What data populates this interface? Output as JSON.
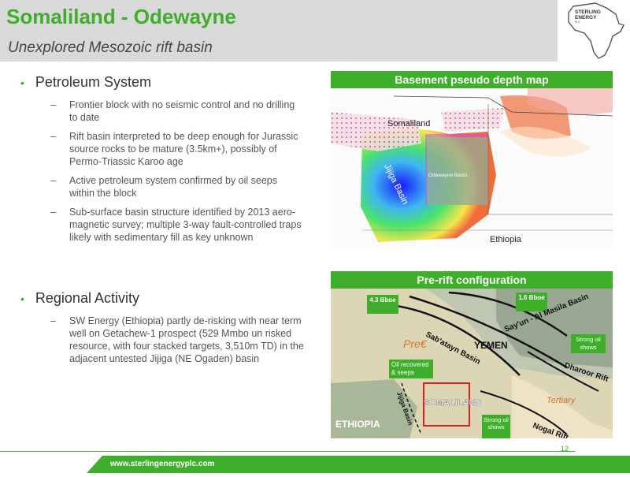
{
  "header": {
    "title": "Somaliland - Odewayne",
    "subtitle": "Unexplored Mesozoic rift basin",
    "logo_text": [
      "STERLING",
      "ENERGY",
      "PLC"
    ]
  },
  "petroleum_system": {
    "title": "Petroleum System",
    "items": [
      "Frontier block with no seismic control and no drilling to date",
      "Rift basin interpreted to be deep enough for Jurassic source rocks to be mature (3.5km+), possibly of Permo-Triassic Karoo age",
      "Active petroleum system confirmed by oil seeps within the block",
      "Sub-surface basin structure identified by 2013 aero-magnetic survey; multiple 3-way fault-controlled traps likely with sedimentary fill as key unknown"
    ]
  },
  "regional_activity": {
    "title": "Regional Activity",
    "items": [
      "SW Energy (Ethiopia) partly de-risking with near term well on Getachew-1 prospect (529 Mmbo un risked resource, with four stacked targets, 3,510m TD) in the adjacent untested Jijiga (NE Ogaden) basin"
    ]
  },
  "map1": {
    "title": "Basement pseudo depth map",
    "labels": {
      "somaliland": "Somaliland",
      "jijiga": "Jijiga Basin",
      "odewayne": "Odewayne Basin",
      "ethiopia": "Ethiopia"
    }
  },
  "map2": {
    "title": "Pre-rift configuration",
    "labels": {
      "bboe43": "4.3 Bboe",
      "bboe16": "1.6 Bboe",
      "sabatayn": "Sab'atayn Basin",
      "sayun": "Say'un - Al Masila Basin",
      "yemen": "YEMEN",
      "prec": "Pre€",
      "oil_recovered": "Oil recovered & seeps",
      "strong_oil_right": "Strong oil shows",
      "dharoor": "Dharoor Rift",
      "tertiary": "Tertiary",
      "somaliland": "SOMALILAND",
      "jijiga": "Jijiga Basin",
      "ethiopia": "ETHIOPIA",
      "strong_oil_bottom": "Strong oil shows",
      "nogal": "Nogal Rift"
    }
  },
  "footer": {
    "url": "www.sterlingenergyplc.com",
    "page": "12"
  },
  "colors": {
    "accent": "#3fae2a",
    "header_bg": "#d9d9d9"
  }
}
